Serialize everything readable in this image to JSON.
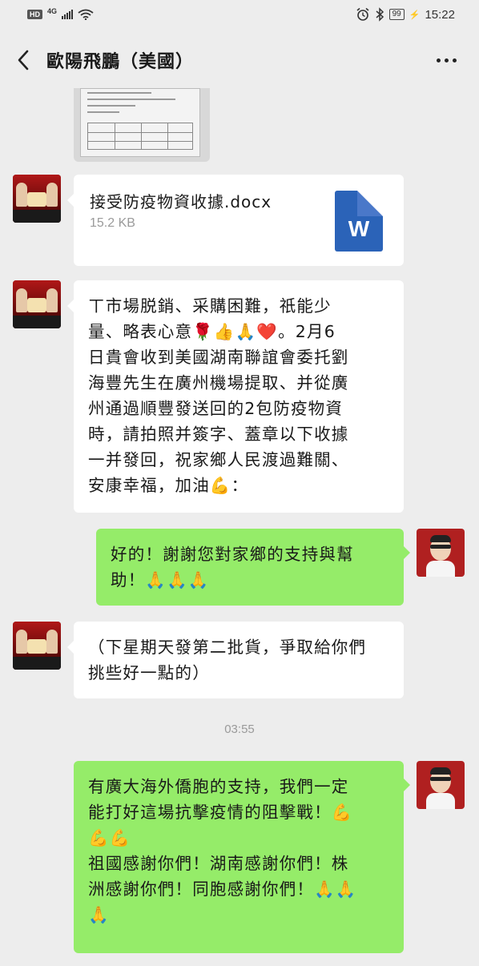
{
  "status_bar": {
    "hd": "HD",
    "network": "4G",
    "battery": "99",
    "time": "15:22"
  },
  "header": {
    "title": "歐陽飛鵬（美國）"
  },
  "messages": {
    "file_name": "接受防疫物資收據.docx",
    "file_size": "15.2 KB",
    "file_icon_letter": "W",
    "m1_lines": [
      "ㄒ市場脱銷、采購困難，祇能少",
      "量、略表心意🌹👍🙏❤️。2月6",
      "日貴會收到美國湖南聯誼會委托劉",
      "海豐先生在廣州機場提取、并從廣",
      "州通過順豐發送回的2包防疫物資",
      "時，請拍照并簽字、蓋章以下收據",
      "一并發回，祝家鄉人民渡過難關、",
      "安康幸福，加油💪："
    ],
    "m2_lines": [
      "好的！謝謝您對家鄉的支持與幫",
      "助！🙏🙏🙏"
    ],
    "m3_lines": [
      "（下星期天發第二批貨，爭取給你們",
      "挑些好一點的）"
    ],
    "timestamp": "03:55",
    "m4_lines": [
      "有廣大海外僑胞的支持，我們一定",
      "能打好這場抗擊疫情的阻擊戰！💪",
      "💪💪",
      "祖國感謝你們！湖南感謝你們！株",
      "洲感謝你們！同胞感謝你們！🙏🙏",
      "🙏"
    ]
  },
  "colors": {
    "background": "#ededed",
    "bubble_self": "#95ec69",
    "bubble_other": "#ffffff",
    "word_blue": "#2b63b8"
  },
  "icons": [
    "back-arrow-icon",
    "more-dots-icon",
    "word-doc-icon",
    "wifi-icon",
    "bluetooth-icon",
    "alarm-icon",
    "signal-icon"
  ]
}
